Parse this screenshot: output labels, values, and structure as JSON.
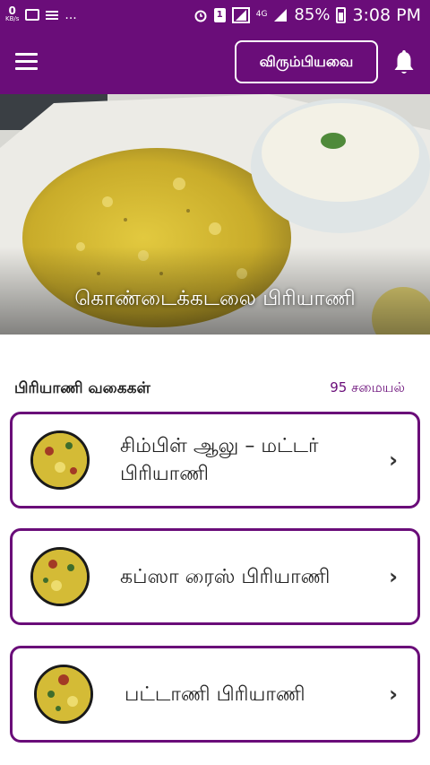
{
  "status_bar": {
    "speed_value": "0",
    "speed_unit": "KB/s",
    "more": "...",
    "sim_label": "1",
    "network": "4G",
    "battery": "85%",
    "time": "3:08 PM"
  },
  "app_bar": {
    "favorites_label": "விரும்பியவை"
  },
  "hero": {
    "title": "கொண்டைக்கடலை பிரியாணி"
  },
  "section": {
    "title": "பிரியாணி வகைகள்",
    "count": "95 சமையல்"
  },
  "recipes": [
    {
      "name": "சிம்பிள் ஆலு – மட்டர் பிரியாணி"
    },
    {
      "name": "கப்ஸா ரைஸ் பிரியாணி"
    },
    {
      "name": "பட்டாணி பிரியாணி"
    }
  ],
  "colors": {
    "primary": "#6a0d79",
    "text": "#222222"
  }
}
